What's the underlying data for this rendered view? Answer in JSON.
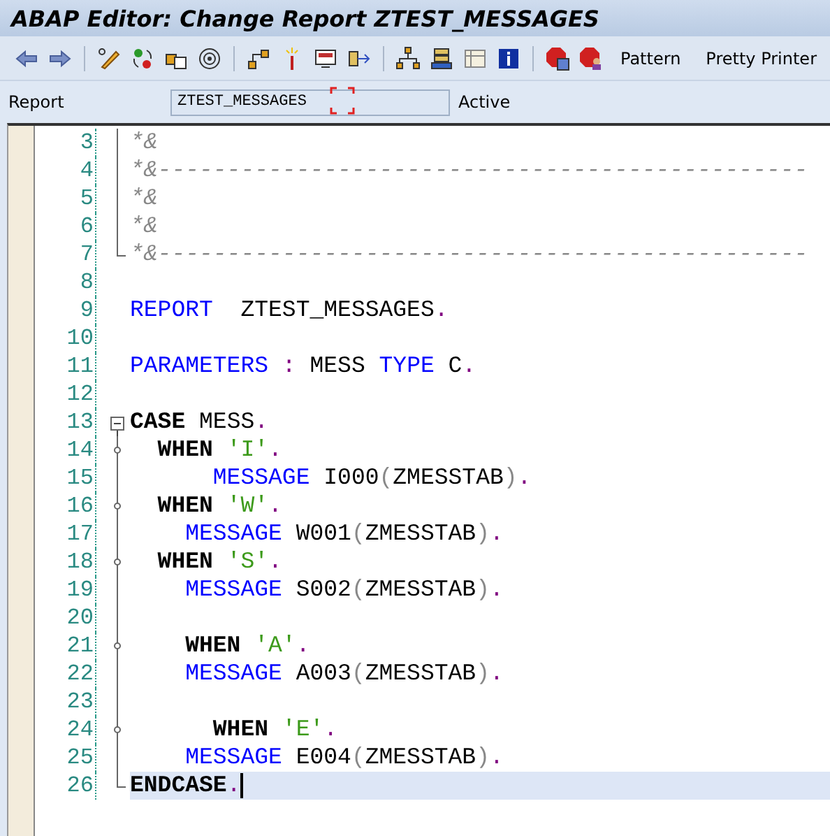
{
  "window": {
    "title": "ABAP Editor: Change Report ZTEST_MESSAGES"
  },
  "toolbar": {
    "buttons": [
      "Pattern",
      "Pretty Printer"
    ]
  },
  "report_row": {
    "label": "Report",
    "value": "ZTEST_MESSAGES",
    "status": "Active"
  },
  "editor": {
    "lines": [
      {
        "number": "3",
        "kind": "line",
        "current": false,
        "tokens": [
          {
            "kind": "comment",
            "text": "*&"
          }
        ]
      },
      {
        "number": "4",
        "kind": "line",
        "current": false,
        "tokens": [
          {
            "kind": "comment",
            "text": "*&-----------------------------------------------"
          }
        ]
      },
      {
        "number": "5",
        "kind": "line",
        "current": false,
        "tokens": [
          {
            "kind": "comment",
            "text": "*&"
          }
        ]
      },
      {
        "number": "6",
        "kind": "line",
        "current": false,
        "tokens": [
          {
            "kind": "comment",
            "text": "*&"
          }
        ]
      },
      {
        "number": "7",
        "kind": "end",
        "current": false,
        "tokens": [
          {
            "kind": "comment",
            "text": "*&-----------------------------------------------"
          }
        ]
      },
      {
        "number": "8",
        "kind": "plain",
        "current": false
      },
      {
        "number": "9",
        "kind": "plain",
        "current": false,
        "tokens": [
          {
            "kind": "keyword",
            "text": "REPORT"
          },
          {
            "kind": "plain",
            "text": "  ZTEST_MESSAGES"
          },
          {
            "kind": "punct",
            "text": "."
          }
        ]
      },
      {
        "number": "10",
        "kind": "plain",
        "current": false
      },
      {
        "number": "11",
        "kind": "plain",
        "current": false,
        "tokens": [
          {
            "kind": "keyword",
            "text": "PARAMETERS"
          },
          {
            "kind": "punct",
            "text": " :"
          },
          {
            "kind": "plain",
            "text": " MESS "
          },
          {
            "kind": "keyword",
            "text": "TYPE"
          },
          {
            "kind": "plain",
            "text": " C"
          },
          {
            "kind": "punct",
            "text": "."
          }
        ]
      },
      {
        "number": "12",
        "kind": "plain",
        "current": false
      },
      {
        "number": "13",
        "kind": "open",
        "current": false,
        "tokens": [
          {
            "kind": "strong",
            "text": "CASE"
          },
          {
            "kind": "plain",
            "text": " MESS"
          },
          {
            "kind": "punct",
            "text": "."
          }
        ]
      },
      {
        "number": "14",
        "kind": "node",
        "current": false,
        "tokens": [
          {
            "kind": "strong",
            "text": "  WHEN"
          },
          {
            "kind": "string",
            "text": " 'I'"
          },
          {
            "kind": "punct",
            "text": "."
          }
        ]
      },
      {
        "number": "15",
        "kind": "line",
        "current": false,
        "tokens": [
          {
            "kind": "keyword",
            "text": "      MESSAGE"
          },
          {
            "kind": "plain",
            "text": " I000"
          },
          {
            "kind": "paren",
            "text": "("
          },
          {
            "kind": "plain",
            "text": "ZMESSTAB"
          },
          {
            "kind": "paren",
            "text": ")"
          },
          {
            "kind": "punct",
            "text": "."
          }
        ]
      },
      {
        "number": "16",
        "kind": "node",
        "current": false,
        "tokens": [
          {
            "kind": "strong",
            "text": "  WHEN"
          },
          {
            "kind": "string",
            "text": " 'W'"
          },
          {
            "kind": "punct",
            "text": "."
          }
        ]
      },
      {
        "number": "17",
        "kind": "line",
        "current": false,
        "tokens": [
          {
            "kind": "keyword",
            "text": "    MESSAGE"
          },
          {
            "kind": "plain",
            "text": " W001"
          },
          {
            "kind": "paren",
            "text": "("
          },
          {
            "kind": "plain",
            "text": "ZMESSTAB"
          },
          {
            "kind": "paren",
            "text": ")"
          },
          {
            "kind": "punct",
            "text": "."
          }
        ]
      },
      {
        "number": "18",
        "kind": "node",
        "current": false,
        "tokens": [
          {
            "kind": "strong",
            "text": "  WHEN"
          },
          {
            "kind": "string",
            "text": " 'S'"
          },
          {
            "kind": "punct",
            "text": "."
          }
        ]
      },
      {
        "number": "19",
        "kind": "line",
        "current": false,
        "tokens": [
          {
            "kind": "keyword",
            "text": "    MESSAGE"
          },
          {
            "kind": "plain",
            "text": " S002"
          },
          {
            "kind": "paren",
            "text": "("
          },
          {
            "kind": "plain",
            "text": "ZMESSTAB"
          },
          {
            "kind": "paren",
            "text": ")"
          },
          {
            "kind": "punct",
            "text": "."
          }
        ]
      },
      {
        "number": "20",
        "kind": "line",
        "current": false
      },
      {
        "number": "21",
        "kind": "node",
        "current": false,
        "tokens": [
          {
            "kind": "strong",
            "text": "    WHEN"
          },
          {
            "kind": "string",
            "text": " 'A'"
          },
          {
            "kind": "punct",
            "text": "."
          }
        ]
      },
      {
        "number": "22",
        "kind": "line",
        "current": false,
        "tokens": [
          {
            "kind": "keyword",
            "text": "    MESSAGE"
          },
          {
            "kind": "plain",
            "text": " A003"
          },
          {
            "kind": "paren",
            "text": "("
          },
          {
            "kind": "plain",
            "text": "ZMESSTAB"
          },
          {
            "kind": "paren",
            "text": ")"
          },
          {
            "kind": "punct",
            "text": "."
          }
        ]
      },
      {
        "number": "23",
        "kind": "line",
        "current": false
      },
      {
        "number": "24",
        "kind": "node",
        "current": false,
        "tokens": [
          {
            "kind": "strong",
            "text": "      WHEN"
          },
          {
            "kind": "string",
            "text": " 'E'"
          },
          {
            "kind": "punct",
            "text": "."
          }
        ]
      },
      {
        "number": "25",
        "kind": "line",
        "current": false,
        "tokens": [
          {
            "kind": "keyword",
            "text": "    MESSAGE"
          },
          {
            "kind": "plain",
            "text": " E004"
          },
          {
            "kind": "paren",
            "text": "("
          },
          {
            "kind": "plain",
            "text": "ZMESSTAB"
          },
          {
            "kind": "paren",
            "text": ")"
          },
          {
            "kind": "punct",
            "text": "."
          }
        ]
      },
      {
        "number": "26",
        "kind": "end",
        "current": true,
        "tokens": [
          {
            "kind": "strong",
            "text": "ENDCASE"
          },
          {
            "kind": "punct",
            "text": "."
          }
        ]
      }
    ]
  }
}
